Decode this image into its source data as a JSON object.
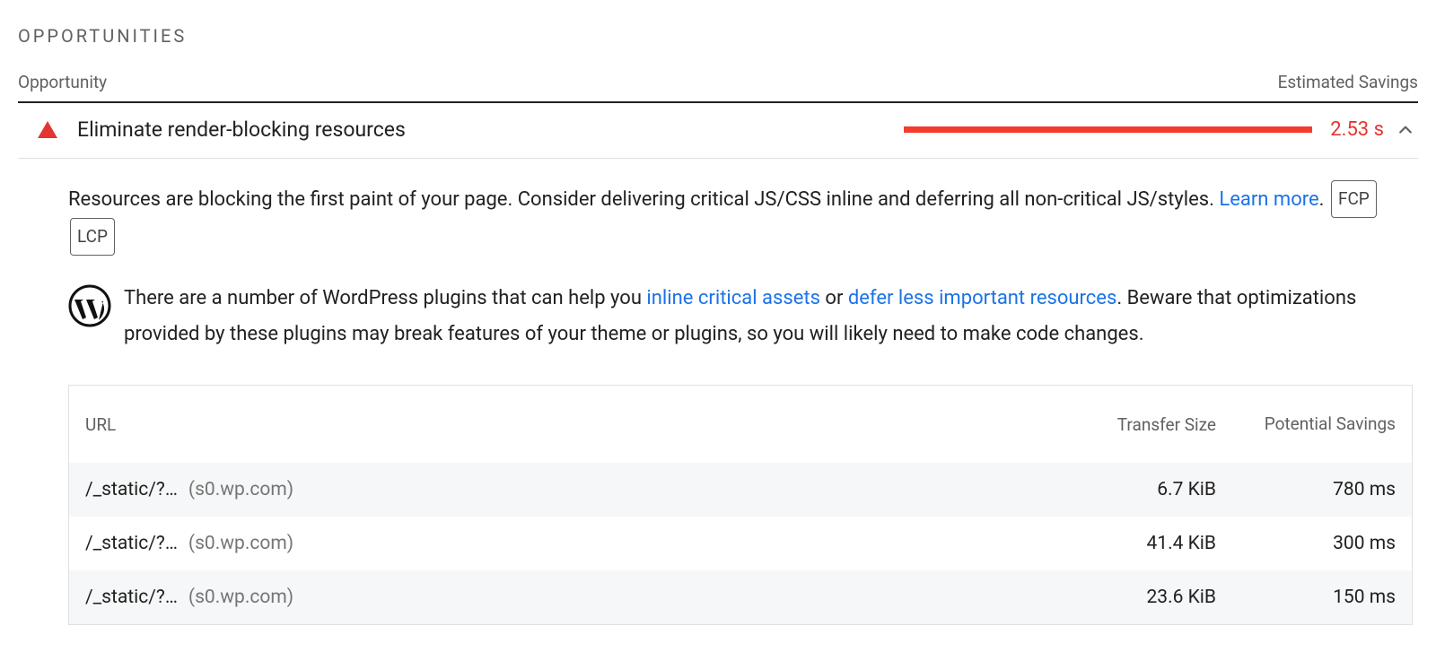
{
  "section_title": "OPPORTUNITIES",
  "header": {
    "left": "Opportunity",
    "right": "Estimated Savings"
  },
  "audit": {
    "title": "Eliminate render-blocking resources",
    "value": "2.53 s",
    "description_pre": "Resources are blocking the first paint of your page. Consider delivering critical JS/CSS inline and deferring all non-critical JS/styles. ",
    "learn_more": "Learn more",
    "description_post": ". ",
    "badges": [
      "FCP",
      "LCP"
    ],
    "wp_text_pre": "There are a number of WordPress plugins that can help you ",
    "wp_link1": "inline critical assets",
    "wp_text_mid": " or ",
    "wp_link2": "defer less important resources",
    "wp_text_post": ". Beware that optimizations provided by these plugins may break features of your theme or plugins, so you will likely need to make code changes."
  },
  "table": {
    "headers": {
      "url": "URL",
      "size": "Transfer Size",
      "savings": "Potential Savings"
    },
    "rows": [
      {
        "path": "/_static/?…",
        "host": "(s0.wp.com)",
        "size": "6.7 KiB",
        "savings": "780 ms"
      },
      {
        "path": "/_static/?…",
        "host": "(s0.wp.com)",
        "size": "41.4 KiB",
        "savings": "300 ms"
      },
      {
        "path": "/_static/?…",
        "host": "(s0.wp.com)",
        "size": "23.6 KiB",
        "savings": "150 ms"
      }
    ]
  }
}
